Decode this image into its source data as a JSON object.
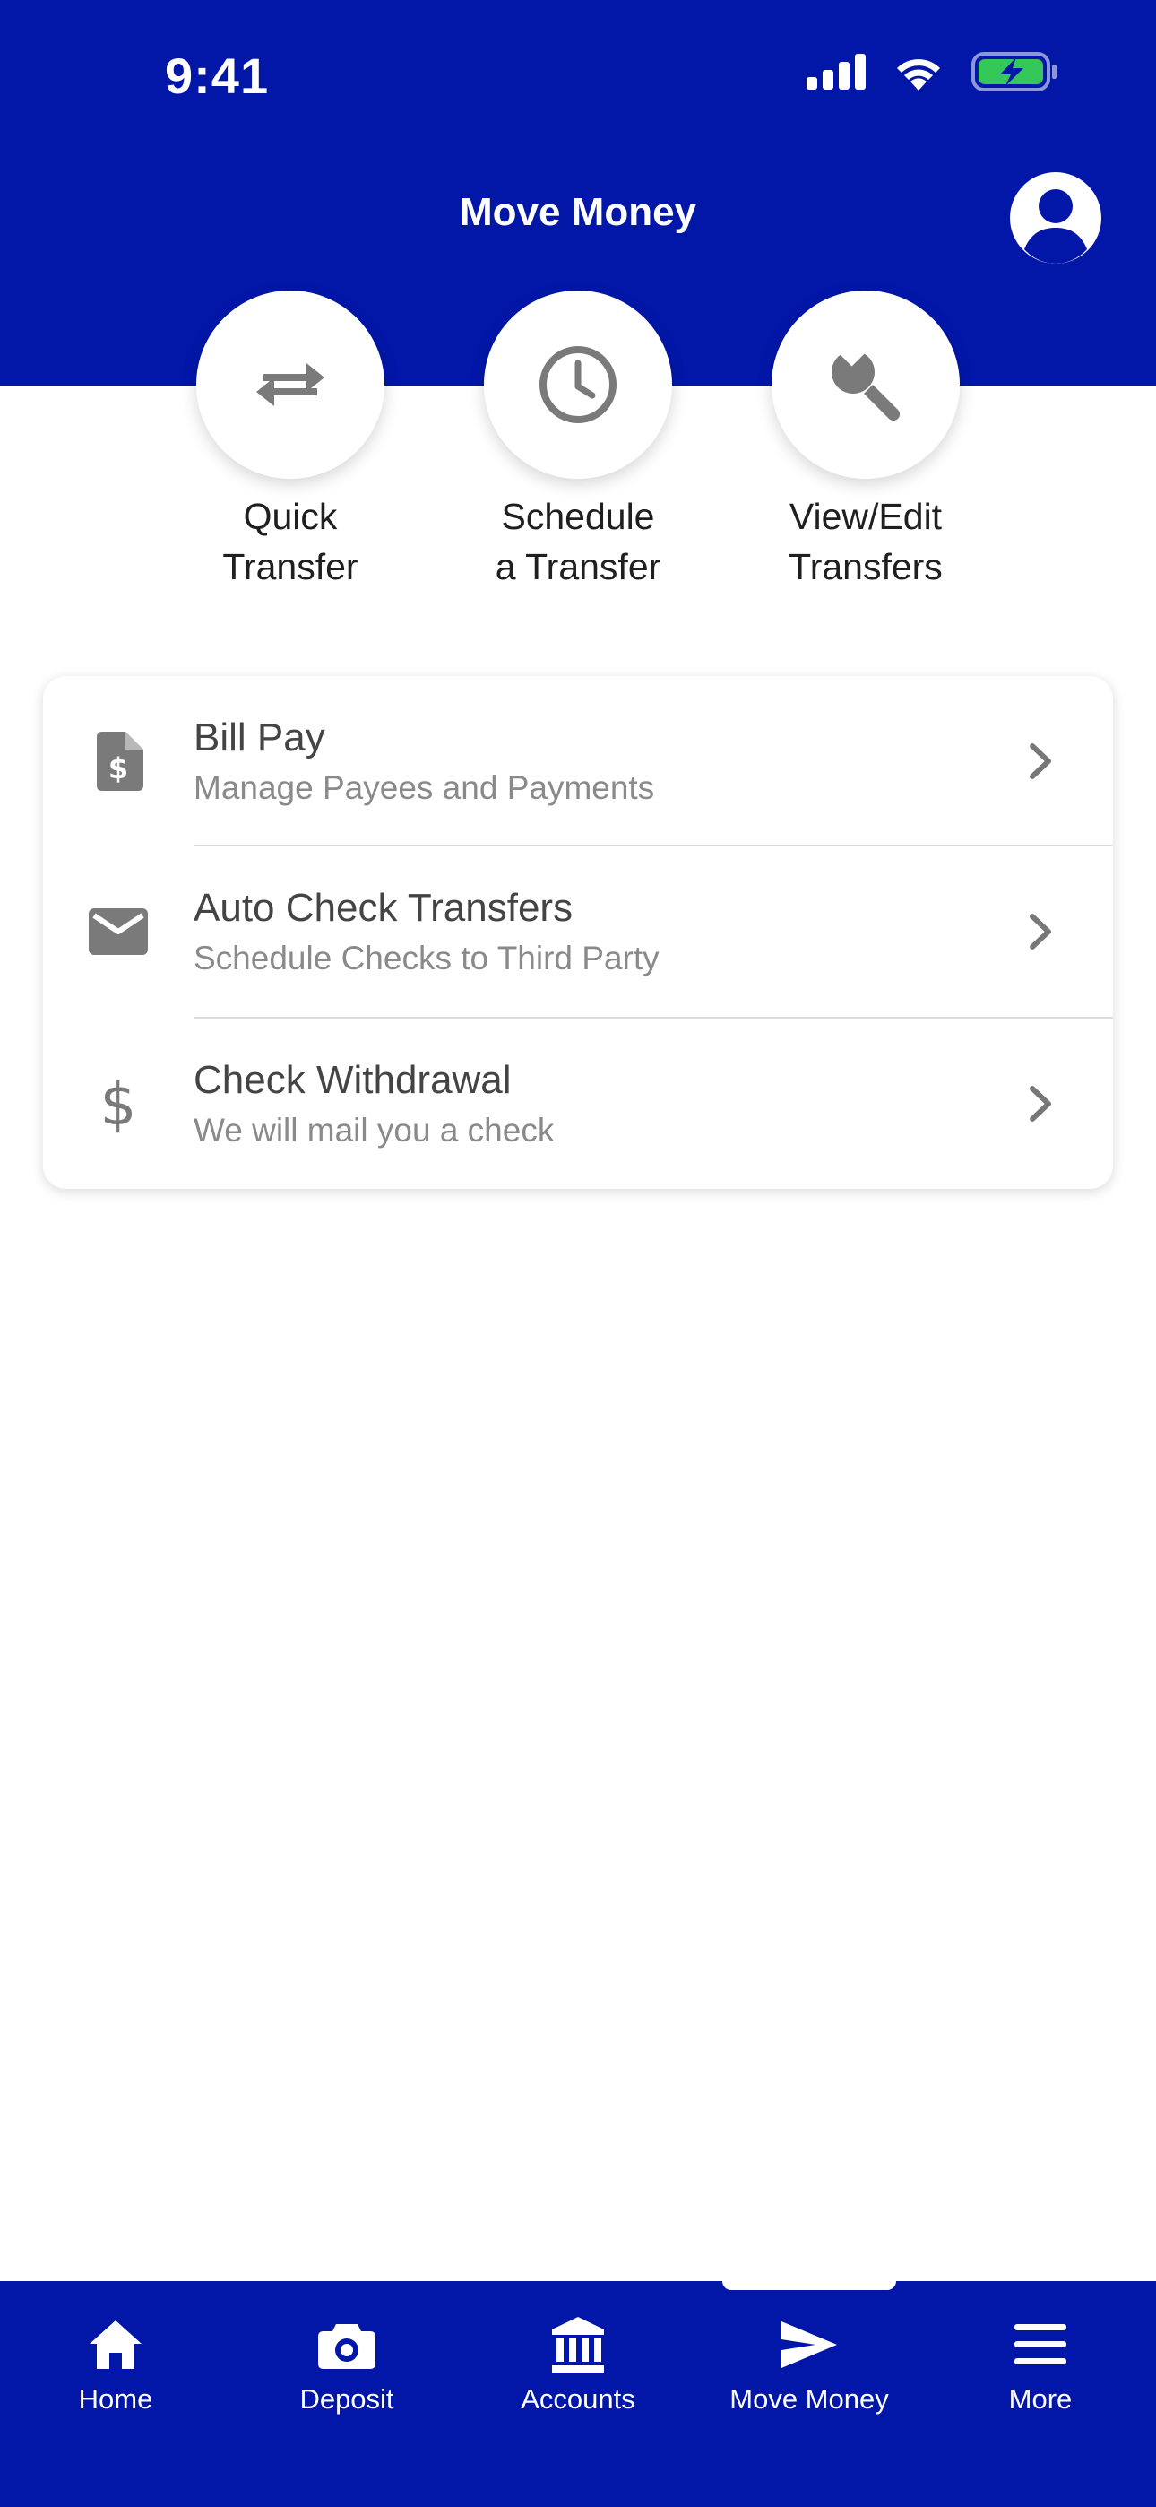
{
  "status_bar": {
    "time": "9:41"
  },
  "header": {
    "title": "Move Money"
  },
  "quick_actions": [
    {
      "label_line1": "Quick",
      "label_line2": "Transfer",
      "icon": "swap-arrows-icon"
    },
    {
      "label_line1": "Schedule",
      "label_line2": "a Transfer",
      "icon": "clock-icon"
    },
    {
      "label_line1": "View/Edit",
      "label_line2": "Transfers",
      "icon": "wrench-icon"
    }
  ],
  "menu": [
    {
      "title": "Bill Pay",
      "subtitle": "Manage Payees and  Payments",
      "icon": "bill-document-icon"
    },
    {
      "title": "Auto Check Transfers",
      "subtitle": "Schedule Checks to Third Party",
      "icon": "envelope-icon"
    },
    {
      "title": "Check Withdrawal",
      "subtitle": "We will mail you a check",
      "icon": "dollar-icon"
    }
  ],
  "tabs": [
    {
      "label": "Home",
      "icon": "home-icon"
    },
    {
      "label": "Deposit",
      "icon": "camera-icon"
    },
    {
      "label": "Accounts",
      "icon": "bank-icon"
    },
    {
      "label": "Move Money",
      "icon": "send-icon",
      "active": true
    },
    {
      "label": "More",
      "icon": "hamburger-menu-icon"
    }
  ],
  "colors": {
    "brand_blue": "#0217A8",
    "icon_gray": "#7a7a7a",
    "battery_green": "#34C759"
  }
}
